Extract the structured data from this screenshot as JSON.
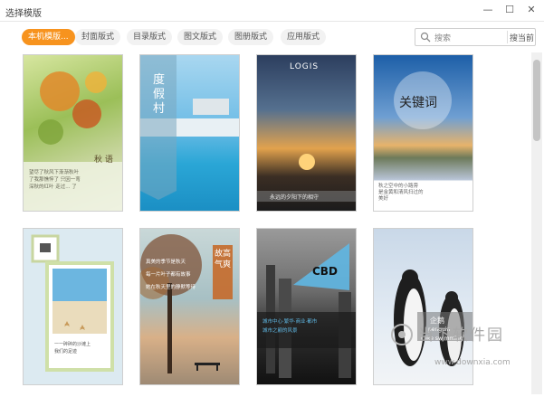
{
  "window": {
    "title": "选择模版",
    "minimize": "—",
    "maximize": "☐",
    "close": "✕"
  },
  "toolbar": {
    "tabs": [
      {
        "label": "本机模版..."
      },
      {
        "label": "封面版式"
      },
      {
        "label": "目录版式"
      },
      {
        "label": "图文版式"
      },
      {
        "label": "图册版式"
      },
      {
        "label": "应用版式"
      }
    ],
    "search": {
      "placeholder": "搜索",
      "scope": "搜当前"
    }
  },
  "templates": [
    {
      "id": "t1",
      "title": "秋 语",
      "body": "望尽了秋风下渐渐秋叶\n了我那憔悴了 只因一弯\n深秋的红叶 走过... 了"
    },
    {
      "id": "t2",
      "title": "度假村",
      "body": ""
    },
    {
      "id": "t3",
      "title": "LOGIS",
      "body": "永远的夕阳下的相守"
    },
    {
      "id": "t4",
      "title": "关键词",
      "body": "秋之空中的小路旁\n是金黄和清风扫过的\n美好"
    },
    {
      "id": "t5",
      "title": "",
      "body": "一一碎碎的沙滩上\n我们的足迹"
    },
    {
      "id": "t6",
      "title": "故高气爽",
      "body": "真美的季节是秋天\n每一片叶子都有故事\n她在秋天里的静默等待"
    },
    {
      "id": "t7",
      "title": "CBD",
      "body": "城市中心·繁华·商业·都市\n城市之巅的风景"
    },
    {
      "id": "t8",
      "title": "企鹅",
      "subtitle": "penguin",
      "body": "I like swimming"
    }
  ],
  "watermark": {
    "name": "当下软件园",
    "url": "www.downxia.com"
  }
}
